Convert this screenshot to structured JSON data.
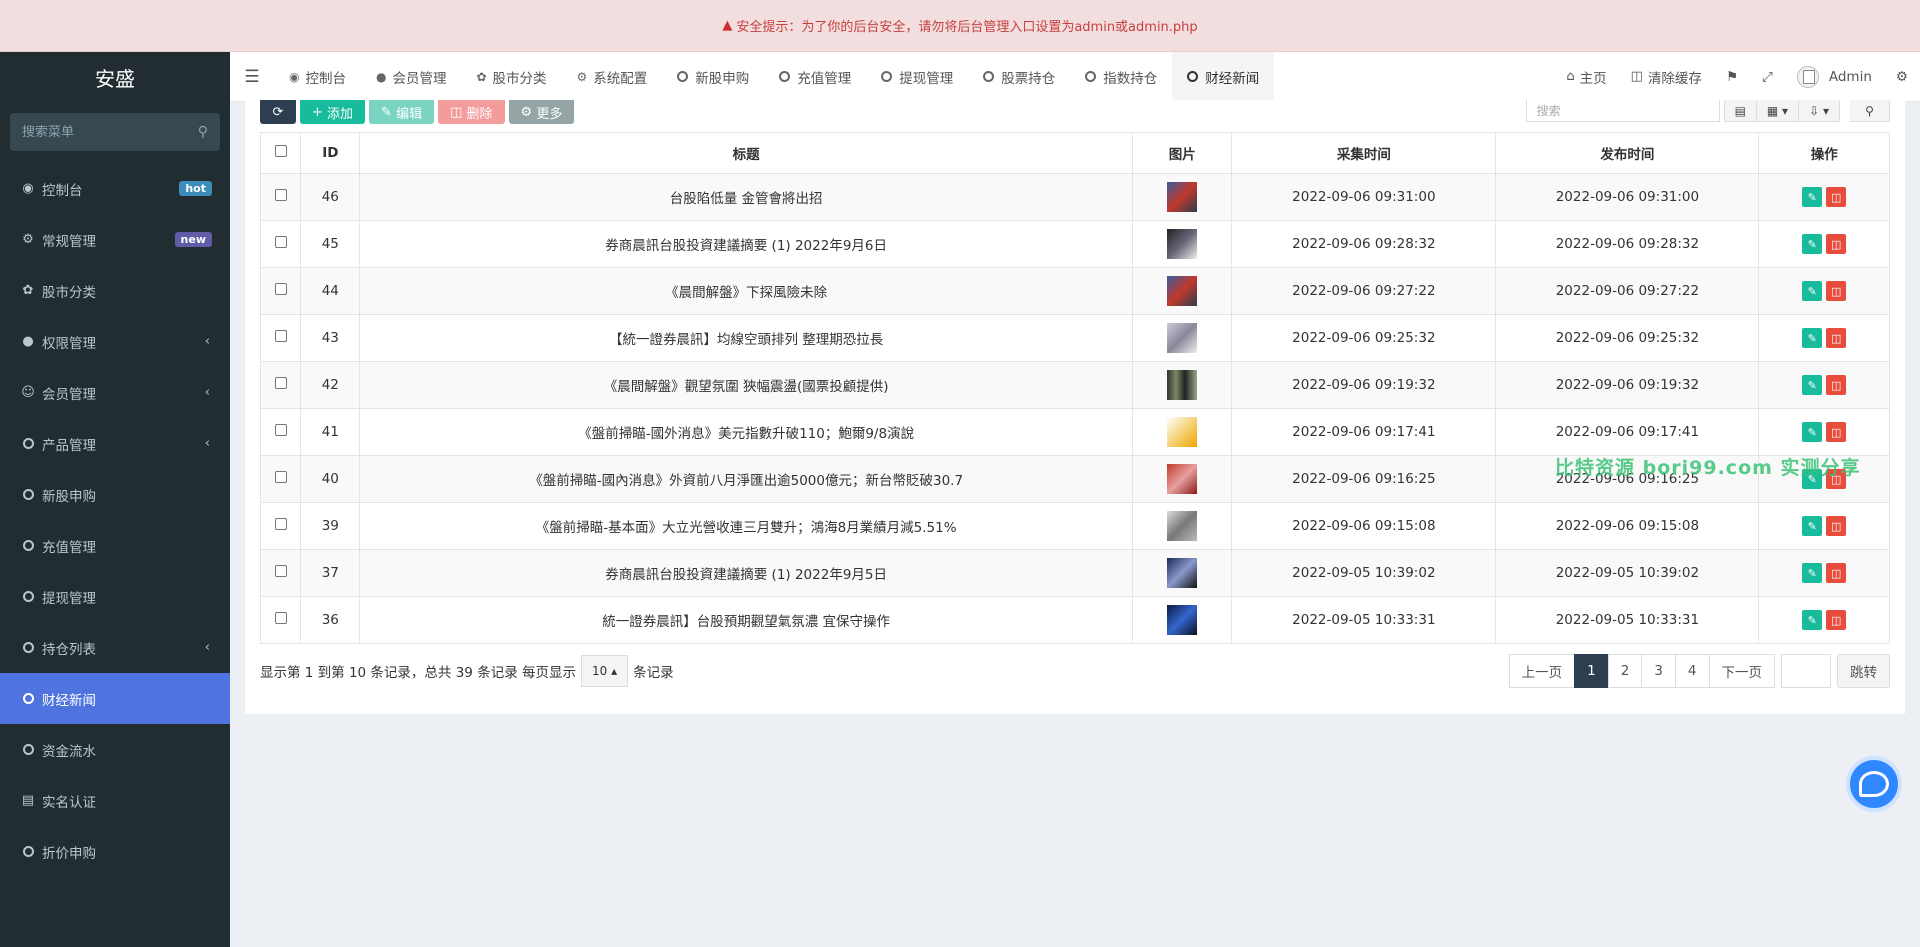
{
  "alert": {
    "text": "安全提示：为了你的后台安全，请勿将后台管理入口设置为admin或admin.php"
  },
  "sidebar": {
    "brand": "安盛",
    "search_placeholder": "搜索菜单",
    "items": [
      {
        "label": "控制台",
        "icon": "dashboard-icon",
        "badge": "hot"
      },
      {
        "label": "常规管理",
        "icon": "cogs-icon",
        "badge": "new"
      },
      {
        "label": "股市分类",
        "icon": "leaf-icon"
      },
      {
        "label": "权限管理",
        "icon": "users-icon"
      },
      {
        "label": "会员管理",
        "icon": "user-circle-icon"
      },
      {
        "label": "产品管理",
        "icon": "circle-icon"
      },
      {
        "label": "新股申购",
        "icon": "circle-icon"
      },
      {
        "label": "充值管理",
        "icon": "circle-icon"
      },
      {
        "label": "提现管理",
        "icon": "circle-icon"
      },
      {
        "label": "持仓列表",
        "icon": "circle-icon"
      },
      {
        "label": "财经新闻",
        "icon": "circle-icon",
        "active": true
      },
      {
        "label": "资金流水",
        "icon": "circle-icon"
      },
      {
        "label": "实名认证",
        "icon": "id-card-icon"
      },
      {
        "label": "折价申购",
        "icon": "circle-icon"
      }
    ]
  },
  "tabs": [
    {
      "label": "控制台",
      "icon": "dashboard-icon"
    },
    {
      "label": "会员管理",
      "icon": "user-icon"
    },
    {
      "label": "股市分类",
      "icon": "leaf-icon"
    },
    {
      "label": "系统配置",
      "icon": "gear-icon"
    },
    {
      "label": "新股申购",
      "icon": "circle-icon"
    },
    {
      "label": "充值管理",
      "icon": "circle-icon"
    },
    {
      "label": "提现管理",
      "icon": "circle-icon"
    },
    {
      "label": "股票持仓",
      "icon": "circle-icon"
    },
    {
      "label": "指数持仓",
      "icon": "circle-icon"
    },
    {
      "label": "财经新闻",
      "icon": "circle-icon",
      "active": true
    }
  ],
  "nav_right": {
    "home": "主页",
    "clear_cache": "清除缓存",
    "user": "Admin"
  },
  "toolbar": {
    "add": "添加",
    "edit": "编辑",
    "delete": "删除",
    "more": "更多",
    "search_placeholder": "搜索"
  },
  "table": {
    "headers": [
      "ID",
      "标题",
      "图片",
      "采集时间",
      "发布时间",
      "操作"
    ],
    "rows": [
      {
        "id": "46",
        "title": "台股陷低量 金管會將出招",
        "collect": "2022-09-06 09:31:00",
        "publish": "2022-09-06 09:31:00"
      },
      {
        "id": "45",
        "title": "券商晨訊台股投資建議摘要 (1) 2022年9月6日",
        "collect": "2022-09-06 09:28:32",
        "publish": "2022-09-06 09:28:32"
      },
      {
        "id": "44",
        "title": "《晨間解盤》下探風險未除",
        "collect": "2022-09-06 09:27:22",
        "publish": "2022-09-06 09:27:22"
      },
      {
        "id": "43",
        "title": "【統一證券晨訊】均線空頭排列 整理期恐拉長",
        "collect": "2022-09-06 09:25:32",
        "publish": "2022-09-06 09:25:32"
      },
      {
        "id": "42",
        "title": "《晨間解盤》觀望氛圍 狹幅震盪(國票投顧提供)",
        "collect": "2022-09-06 09:19:32",
        "publish": "2022-09-06 09:19:32"
      },
      {
        "id": "41",
        "title": "《盤前掃瞄-國外消息》美元指數升破110；鮑爾9/8演說",
        "collect": "2022-09-06 09:17:41",
        "publish": "2022-09-06 09:17:41"
      },
      {
        "id": "40",
        "title": "《盤前掃瞄-國內消息》外資前八月淨匯出逾5000億元；新台幣貶破30.7",
        "collect": "2022-09-06 09:16:25",
        "publish": "2022-09-06 09:16:25"
      },
      {
        "id": "39",
        "title": "《盤前掃瞄-基本面》大立光營收連三月雙升；鴻海8月業績月減5.51%",
        "collect": "2022-09-06 09:15:08",
        "publish": "2022-09-06 09:15:08"
      },
      {
        "id": "37",
        "title": "券商晨訊台股投資建議摘要 (1) 2022年9月5日",
        "collect": "2022-09-05 10:39:02",
        "publish": "2022-09-05 10:39:02"
      },
      {
        "id": "36",
        "title": "統一證券晨訊】台股預期觀望氣氛濃 宜保守操作",
        "collect": "2022-09-05 10:33:31",
        "publish": "2022-09-05 10:33:31"
      }
    ]
  },
  "pagination": {
    "info_prefix": "显示第 1 到第 10 条记录，总共 39 条记录 每页显示",
    "page_size": "10",
    "info_suffix": "条记录",
    "prev": "上一页",
    "pages": [
      "1",
      "2",
      "3",
      "4"
    ],
    "next": "下一页",
    "jump": "跳转"
  },
  "watermark": "比特资源 bori99.com 实测分享",
  "colors": {
    "sidebar_bg": "#222d32",
    "sidebar_active": "#4f74e0",
    "add_button": "#18bc9c",
    "delete_button": "#e74c3c",
    "pager_current": "#2c3e50"
  }
}
